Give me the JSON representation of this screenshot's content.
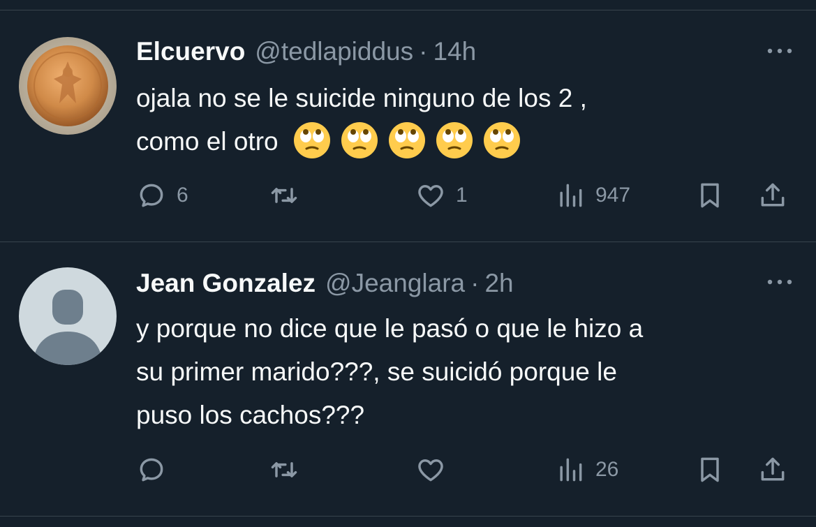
{
  "tweets": [
    {
      "display_name": "Elcuervo",
      "handle": "@tedlapiddus",
      "separator": "·",
      "time": "14h",
      "text_lines": [
        "ojala no se le suicide ninguno de los 2 ,",
        "como el otro"
      ],
      "emojis": [
        "face-with-rolling-eyes",
        "face-with-rolling-eyes",
        "face-with-rolling-eyes",
        "face-with-rolling-eyes",
        "face-with-rolling-eyes"
      ],
      "avatar": "gold-coin-avatar",
      "replies": "6",
      "retweets": "",
      "likes": "1",
      "views": "947"
    },
    {
      "display_name": "Jean Gonzalez",
      "handle": "@Jeanglara",
      "separator": "·",
      "time": "2h",
      "text_lines": [
        "y porque no dice que le pasó o que le hizo a",
        "su primer marido???, se suicidó porque le",
        "puso los cachos???"
      ],
      "avatar": "default-person-avatar",
      "replies": "",
      "retweets": "",
      "likes": "",
      "views": "26"
    }
  ],
  "colors": {
    "background": "#15202b",
    "divider": "#38444d",
    "text_primary": "#f7f9f9",
    "text_secondary": "#8b98a5"
  }
}
